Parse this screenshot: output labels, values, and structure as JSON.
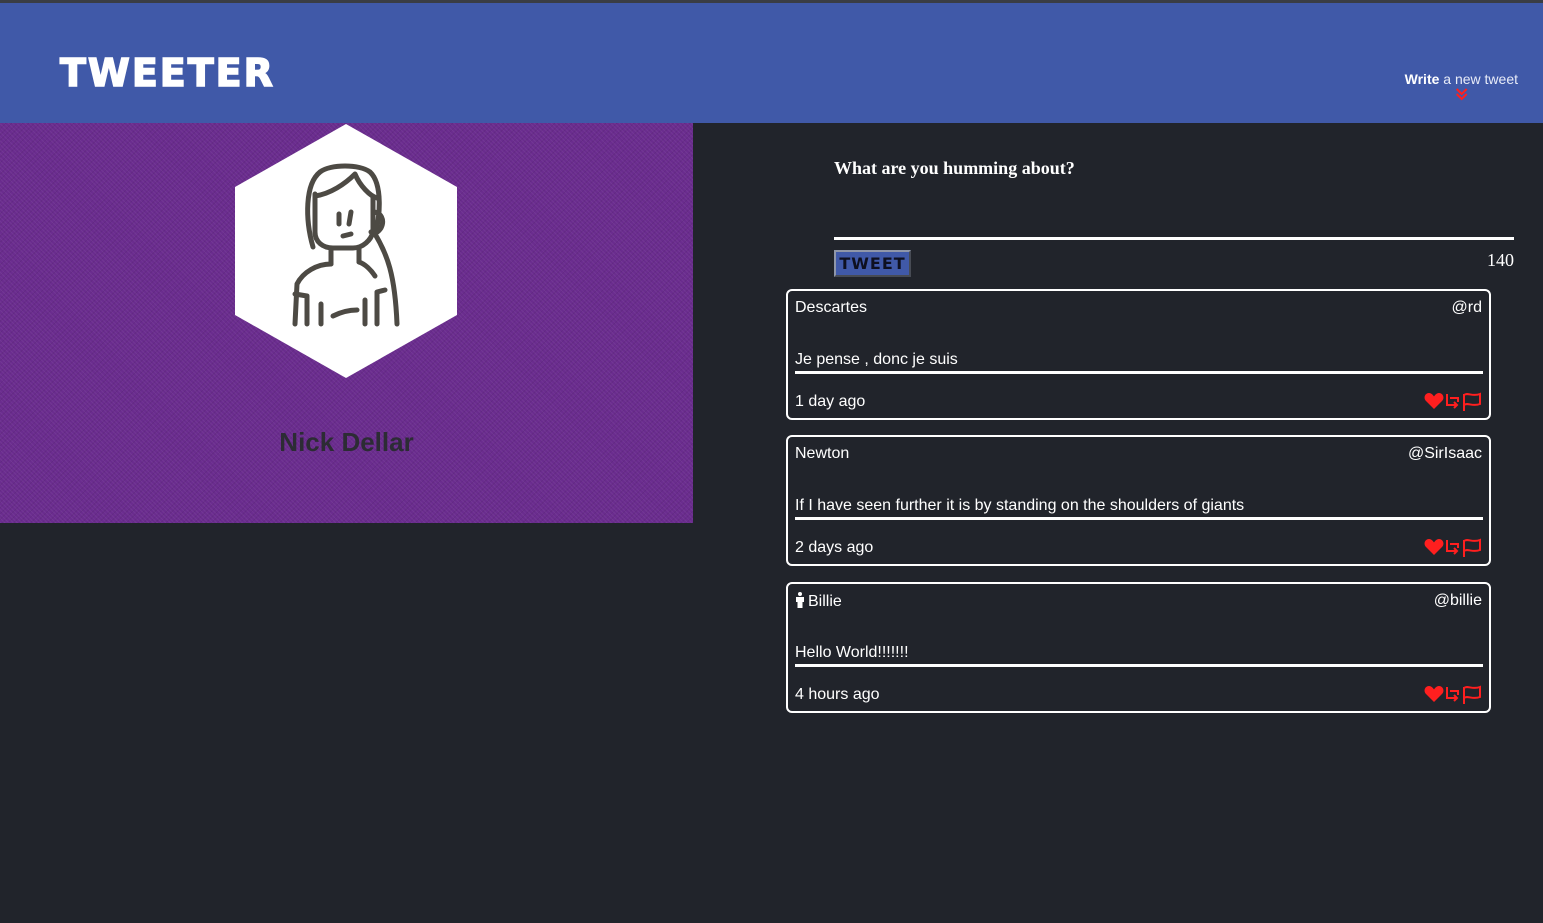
{
  "nav": {
    "brand": "TWEETER",
    "compose_bold": "Write",
    "compose_rest": " a new tweet",
    "chevron_icon": "double-chevron-down-icon",
    "accent": "#ff1f1f"
  },
  "profile": {
    "avatar_icon": "woman-avatar-icon",
    "name": "Nick Dellar",
    "background": "#6a2c8e"
  },
  "compose": {
    "label": "What are you humming about?",
    "textarea_value": "",
    "button_label": "TWEET",
    "counter": "140"
  },
  "tweets": [
    {
      "name": "Descartes",
      "handle": "@rd",
      "content": "Je pense , donc je suis",
      "time": "1 day ago",
      "has_person_icon": false
    },
    {
      "name": "Newton",
      "handle": "@SirIsaac",
      "content": "If I have seen further it is by standing on the shoulders of giants",
      "time": "2 days ago",
      "has_person_icon": false
    },
    {
      "name": "Billie",
      "handle": "@billie",
      "content": "Hello World!!!!!!!",
      "time": "4 hours ago",
      "has_person_icon": true
    }
  ],
  "colors": {
    "navbar": "#4059a8",
    "page_bg": "#21242b",
    "action_red": "#ff1f1f"
  }
}
